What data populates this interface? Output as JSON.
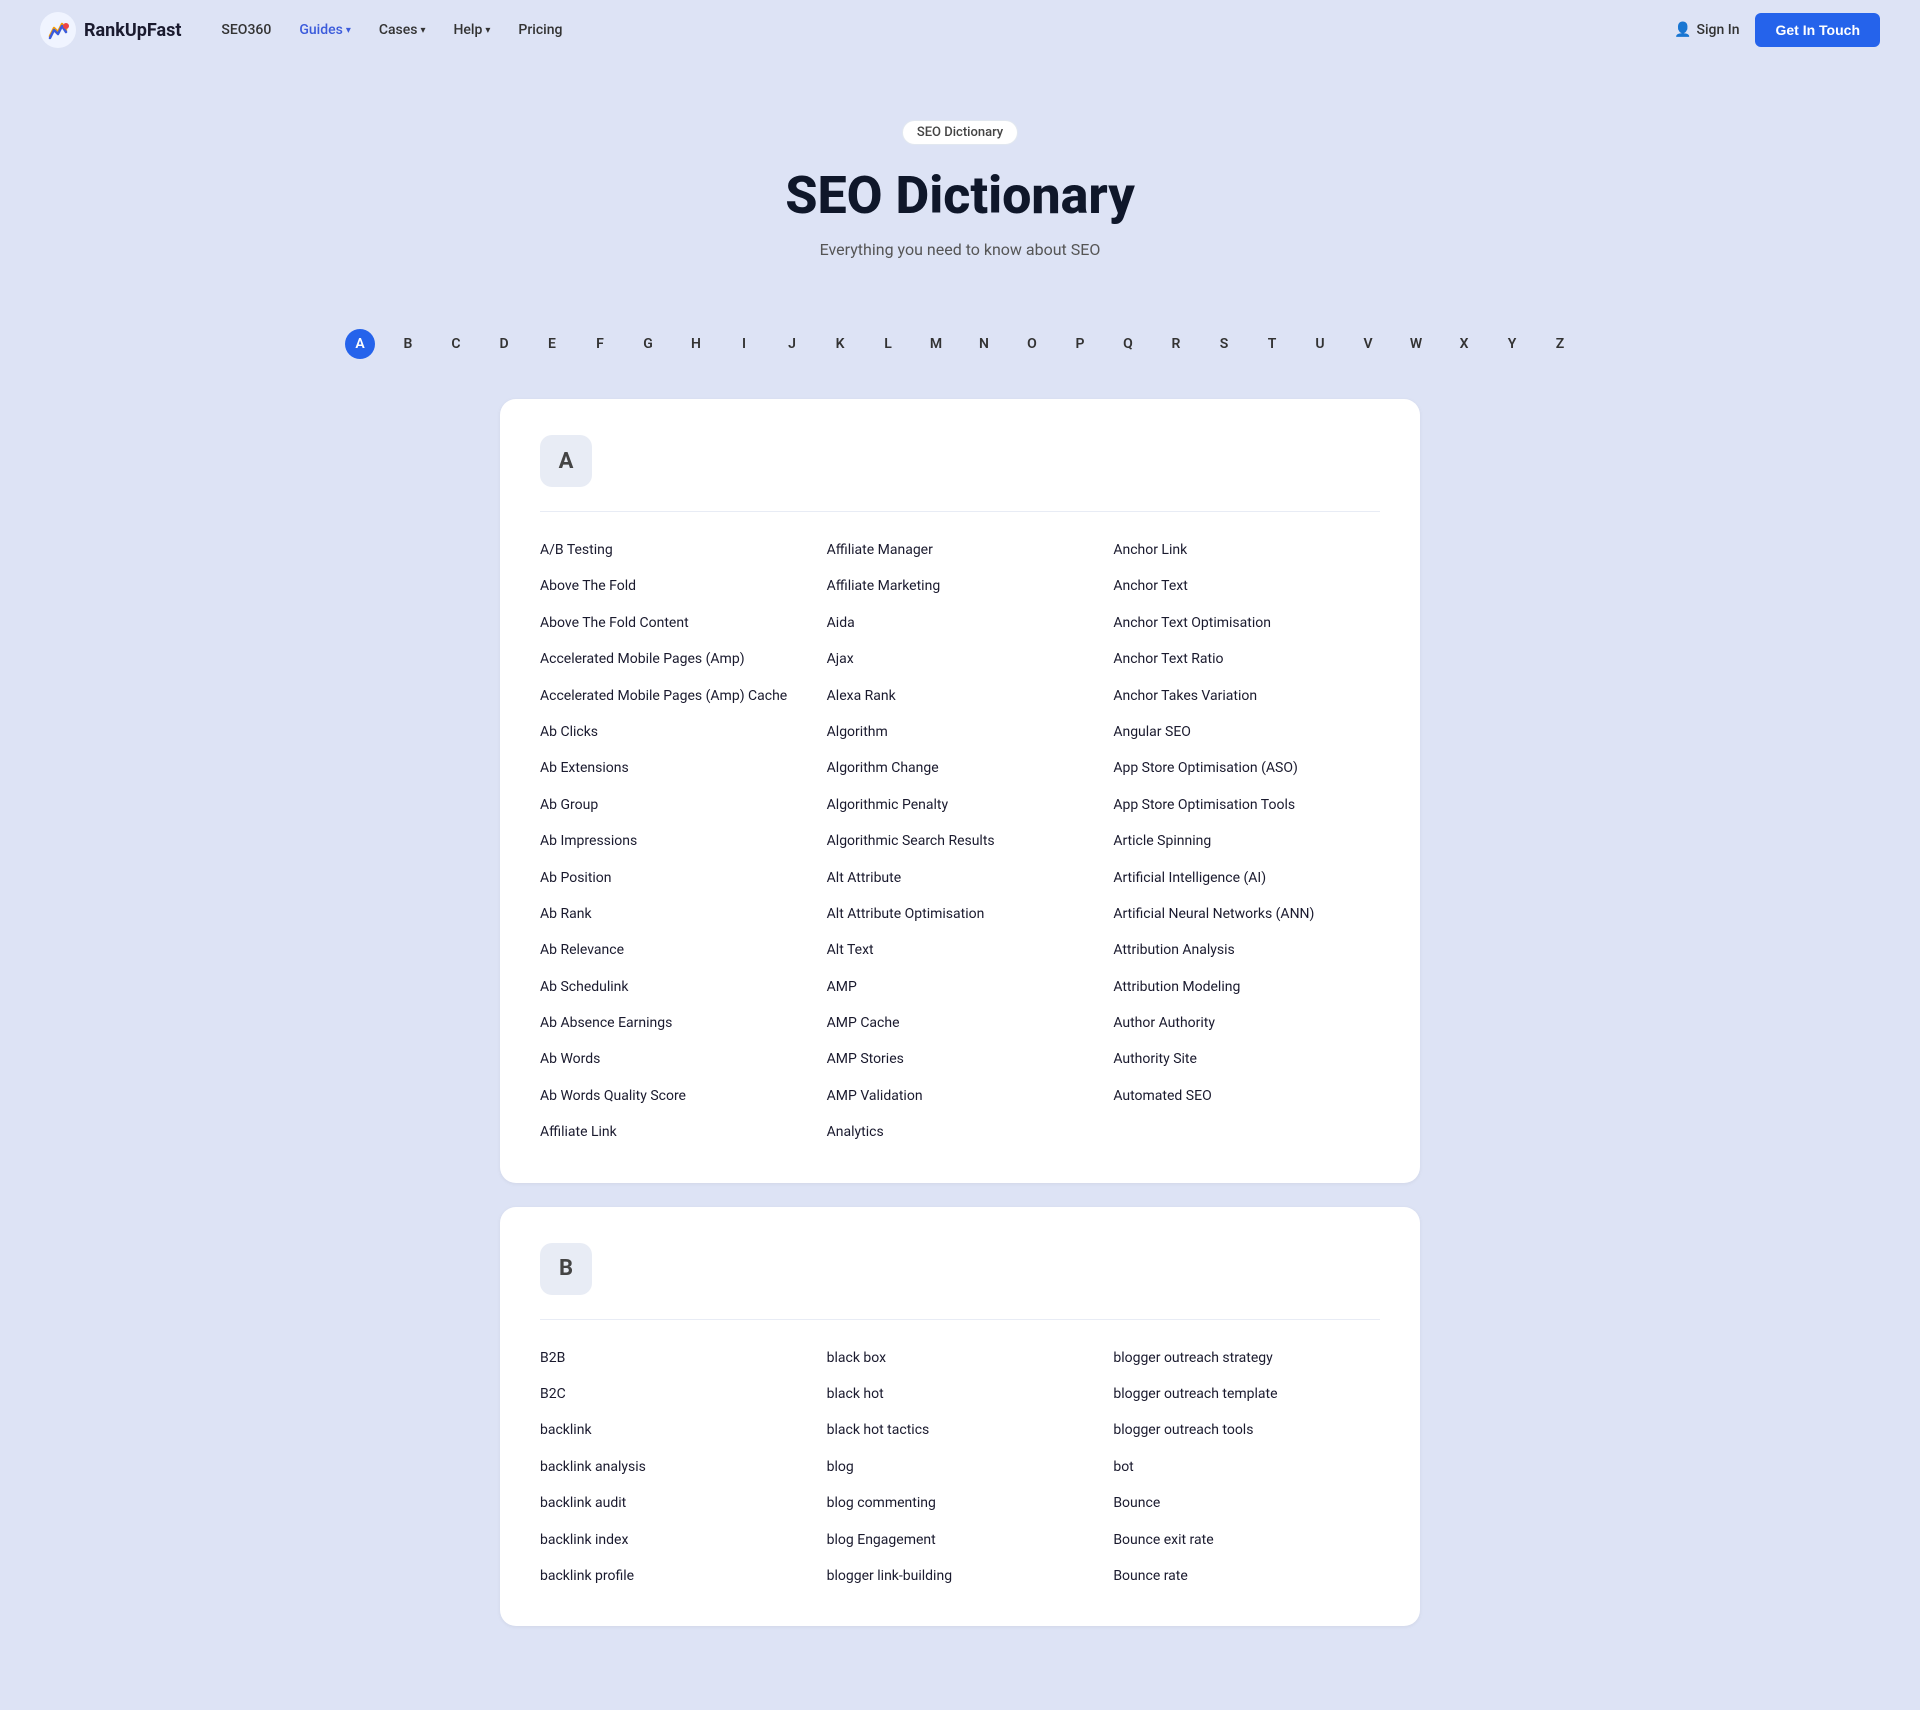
{
  "nav": {
    "logo_text": "RankUpFast",
    "links": [
      {
        "label": "SEO360",
        "hasDropdown": false,
        "active": false
      },
      {
        "label": "Guides",
        "hasDropdown": true,
        "active": true
      },
      {
        "label": "Cases",
        "hasDropdown": true,
        "active": false
      },
      {
        "label": "Help",
        "hasDropdown": true,
        "active": false
      },
      {
        "label": "Pricing",
        "hasDropdown": false,
        "active": false
      }
    ],
    "sign_in": "Sign In",
    "get_in_touch": "Get In Touch"
  },
  "hero": {
    "badge": "SEO Dictionary",
    "title": "SEO Dictionary",
    "subtitle": "Everything you need to know about SEO"
  },
  "alphabet": [
    "A",
    "B",
    "C",
    "D",
    "E",
    "F",
    "G",
    "H",
    "I",
    "J",
    "K",
    "L",
    "M",
    "N",
    "O",
    "P",
    "Q",
    "R",
    "S",
    "T",
    "U",
    "V",
    "W",
    "X",
    "Y",
    "Z"
  ],
  "active_letter": "A",
  "sections": [
    {
      "letter": "A",
      "columns": [
        [
          "A/B Testing",
          "Above The Fold",
          "Above The Fold Content",
          "Accelerated Mobile Pages (Amp)",
          "Accelerated Mobile Pages (Amp) Cache",
          "Ab Clicks",
          "Ab Extensions",
          "Ab Group",
          "Ab Impressions",
          "Ab Position",
          "Ab Rank",
          "Ab Relevance",
          "Ab Schedulink",
          "Ab Absence Earnings",
          "Ab Words",
          "Ab Words Quality Score",
          "Affiliate Link"
        ],
        [
          "Affiliate Manager",
          "Affiliate Marketing",
          "Aida",
          "Ajax",
          "Alexa Rank",
          "Algorithm",
          "Algorithm Change",
          "Algorithmic Penalty",
          "Algorithmic Search Results",
          "Alt Attribute",
          "Alt Attribute Optimisation",
          "Alt Text",
          "AMP",
          "AMP Cache",
          "AMP Stories",
          "AMP Validation",
          "Analytics"
        ],
        [
          "Anchor Link",
          "Anchor Text",
          "Anchor Text Optimisation",
          "Anchor Text Ratio",
          "Anchor Takes Variation",
          "Angular SEO",
          "App Store Optimisation (ASO)",
          "App Store Optimisation Tools",
          "Article Spinning",
          "Artificial Intelligence (AI)",
          "Artificial Neural Networks (ANN)",
          "Attribution Analysis",
          "Attribution Modeling",
          "Author Authority",
          "Authority Site",
          "Automated SEO",
          ""
        ]
      ]
    },
    {
      "letter": "B",
      "columns": [
        [
          "B2B",
          "B2C",
          "backlink",
          "backlink analysis",
          "backlink audit",
          "backlink index",
          "backlink profile"
        ],
        [
          "black box",
          "black hot",
          "black hot tactics",
          "blog",
          "blog commenting",
          "blog Engagement",
          "blogger link-building"
        ],
        [
          "blogger outreach strategy",
          "blogger outreach template",
          "blogger outreach tools",
          "bot",
          "Bounce",
          "Bounce exit rate",
          "Bounce rate"
        ]
      ]
    }
  ]
}
